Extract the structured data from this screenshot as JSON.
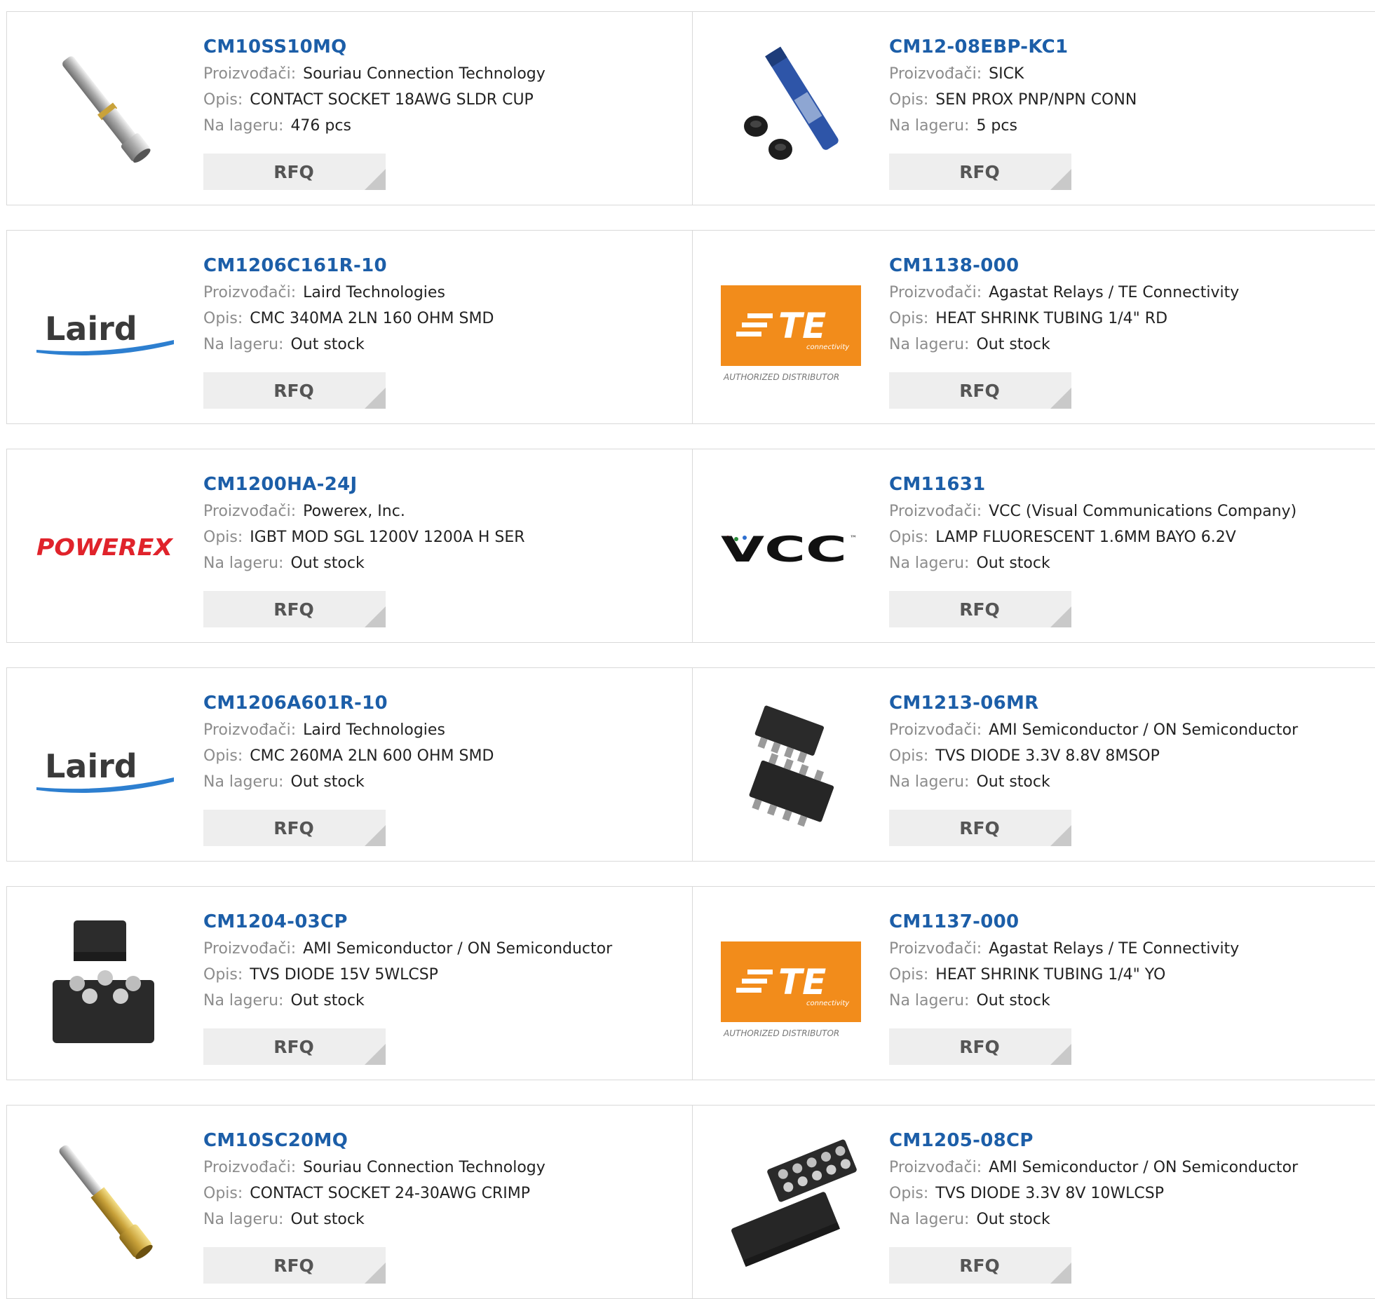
{
  "labels": {
    "manufacturer": "Proizvođači:",
    "description": "Opis:",
    "stock": "Na lageru:",
    "rfq": "RFQ"
  },
  "logos": {
    "laird": "Laird",
    "powerex": "POWEREX",
    "vcc": "VCC",
    "vcc_tm": "™",
    "te": "TE",
    "te_sub": "connectivity",
    "te_authorized": "AUTHORIZED DISTRIBUTOR"
  },
  "colors": {
    "part_number": "#1c5ea8",
    "label": "#8c8c8c",
    "rfq_bg": "#eeeeee",
    "te_orange": "#f28c1b",
    "powerex_red": "#e0232b"
  },
  "products": [
    {
      "part": "CM10SS10MQ",
      "manufacturer": "Souriau Connection Technology",
      "description": "CONTACT SOCKET 18AWG SLDR CUP",
      "stock": "476 pcs",
      "image": "contact-socket-icon"
    },
    {
      "part": "CM12-08EBP-KC1",
      "manufacturer": "SICK",
      "description": "SEN PROX PNP/NPN CONN",
      "stock": "5 pcs",
      "image": "proximity-sensor-icon"
    },
    {
      "part": "CM1206C161R-10",
      "manufacturer": "Laird Technologies",
      "description": "CMC 340MA 2LN 160 OHM SMD",
      "stock": "Out stock",
      "image": "laird-logo"
    },
    {
      "part": "CM1138-000",
      "manufacturer": "Agastat Relays / TE Connectivity",
      "description": "HEAT SHRINK TUBING 1/4\" RD",
      "stock": "Out stock",
      "image": "te-logo"
    },
    {
      "part": "CM1200HA-24J",
      "manufacturer": "Powerex, Inc.",
      "description": "IGBT MOD SGL 1200V 1200A H SER",
      "stock": "Out stock",
      "image": "powerex-logo"
    },
    {
      "part": "CM11631",
      "manufacturer": "VCC (Visual Communications Company)",
      "description": "LAMP FLUORESCENT 1.6MM BAYO 6.2V",
      "stock": "Out stock",
      "image": "vcc-logo"
    },
    {
      "part": "CM1206A601R-10",
      "manufacturer": "Laird Technologies",
      "description": "CMC 260MA 2LN 600 OHM SMD",
      "stock": "Out stock",
      "image": "laird-logo"
    },
    {
      "part": "CM1213-06MR",
      "manufacturer": "AMI Semiconductor / ON Semiconductor",
      "description": "TVS DIODE 3.3V 8.8V 8MSOP",
      "stock": "Out stock",
      "image": "msop-chip-icon"
    },
    {
      "part": "CM1204-03CP",
      "manufacturer": "AMI Semiconductor / ON Semiconductor",
      "description": "TVS DIODE 15V 5WLCSP",
      "stock": "Out stock",
      "image": "wlcsp-chip-icon"
    },
    {
      "part": "CM1137-000",
      "manufacturer": "Agastat Relays / TE Connectivity",
      "description": "HEAT SHRINK TUBING 1/4\" YO",
      "stock": "Out stock",
      "image": "te-logo"
    },
    {
      "part": "CM10SC20MQ",
      "manufacturer": "Souriau Connection Technology",
      "description": "CONTACT SOCKET 24-30AWG CRIMP",
      "stock": "Out stock",
      "image": "crimp-socket-icon"
    },
    {
      "part": "CM1205-08CP",
      "manufacturer": "AMI Semiconductor / ON Semiconductor",
      "description": "TVS DIODE 3.3V 8V 10WLCSP",
      "stock": "Out stock",
      "image": "wlcsp10-chip-icon"
    }
  ]
}
